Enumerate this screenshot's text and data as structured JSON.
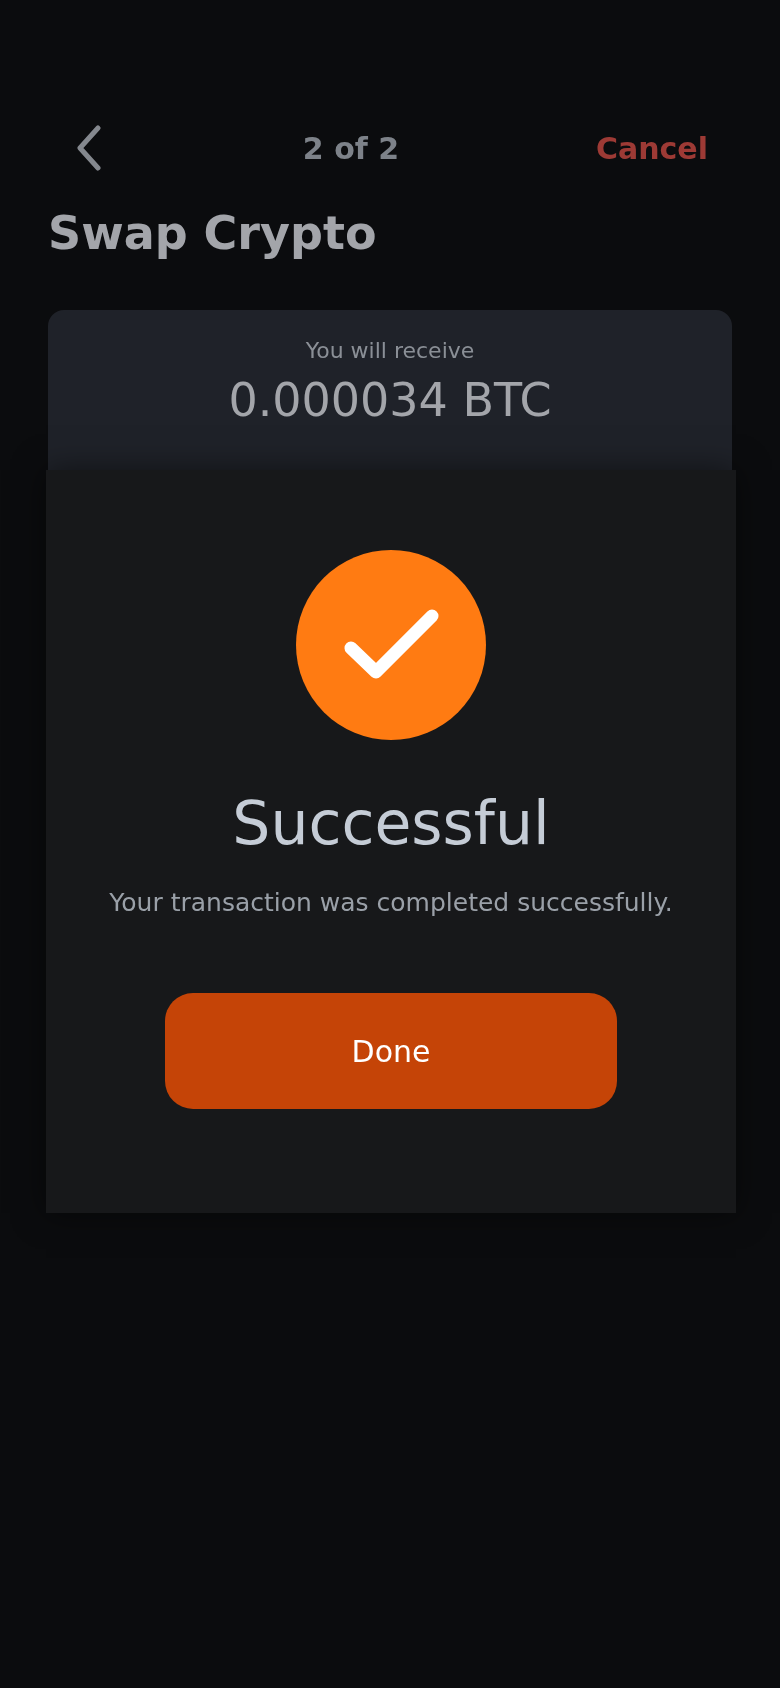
{
  "header": {
    "step": "2 of 2",
    "cancel": "Cancel"
  },
  "title": "Swap Crypto",
  "summary": {
    "label": "You will receive",
    "amount": "0.000034 BTC"
  },
  "dialog": {
    "title": "Successful",
    "message": "Your transaction was completed successfully.",
    "button": "Done"
  }
}
